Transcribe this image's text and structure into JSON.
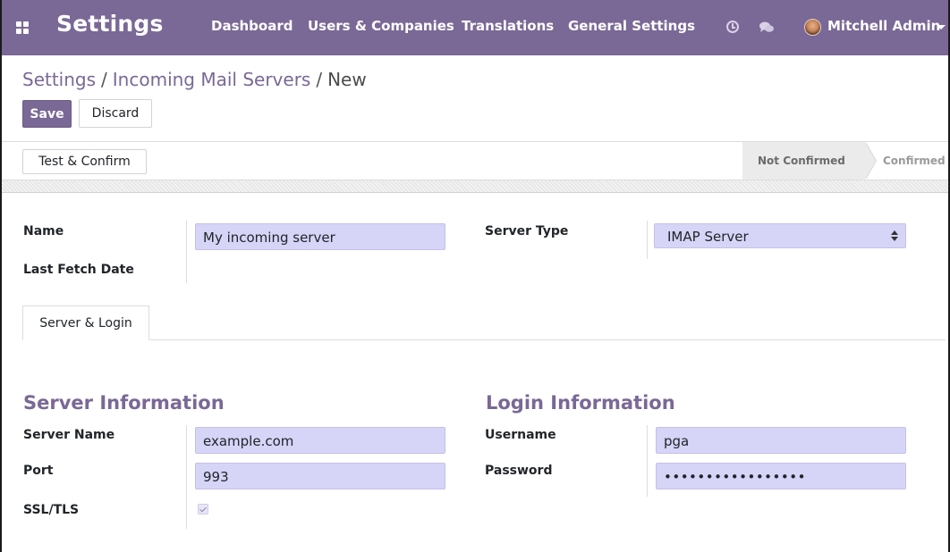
{
  "navbar": {
    "brand": "Settings",
    "menu": [
      "Dashboard",
      "Users & Companies",
      "Translations",
      "General Settings"
    ],
    "user": "Mitchell Admin"
  },
  "breadcrumb": {
    "parent": "Settings",
    "separator1": "/",
    "section": "Incoming Mail Servers",
    "separator2": "/",
    "current": "New"
  },
  "buttons": {
    "save": "Save",
    "discard": "Discard",
    "test_confirm": "Test & Confirm"
  },
  "statusbar": {
    "stages": [
      "Not Confirmed",
      "Confirmed"
    ],
    "active": "Not Confirmed"
  },
  "form": {
    "name_label": "Name",
    "name_value": "My incoming server",
    "last_fetch_label": "Last Fetch Date",
    "server_type_label": "Server Type",
    "server_type_value": "IMAP Server"
  },
  "tabs": [
    "Server & Login"
  ],
  "server_info": {
    "title": "Server Information",
    "server_name_label": "Server Name",
    "server_name_value": "example.com",
    "port_label": "Port",
    "port_value": "993",
    "ssl_label": "SSL/TLS",
    "ssl_checked": true
  },
  "login_info": {
    "title": "Login Information",
    "username_label": "Username",
    "username_value": "pga",
    "password_label": "Password",
    "password_value": "•••••••••••••••••"
  },
  "colors": {
    "brand": "#7a6896",
    "field_bg": "#d6d4f7"
  }
}
